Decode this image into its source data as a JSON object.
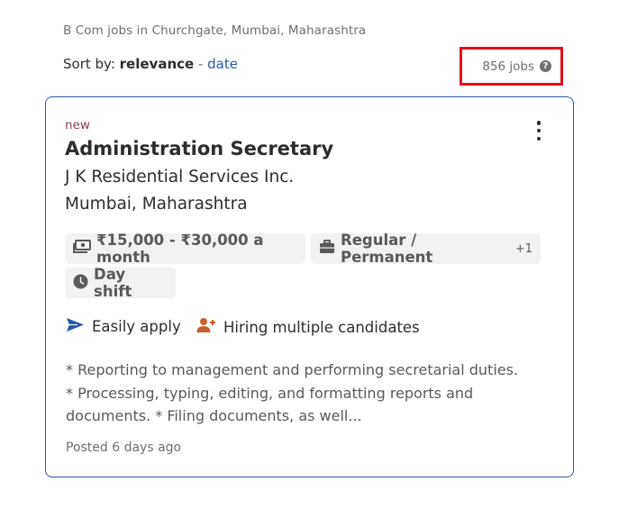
{
  "breadcrumb": "B Com jobs in Churchgate, Mumbai, Maharashtra",
  "sort": {
    "prefix": "Sort by: ",
    "active": "relevance",
    "separator": " - ",
    "alternate": "date"
  },
  "job_count": "856 jobs",
  "job_count_help_icon": "question-circle-icon",
  "card": {
    "new_label": "new",
    "title": "Administration Secretary",
    "company": "J K Residential Services Inc.",
    "location": "Mumbai, Maharashtra",
    "tags": {
      "salary": "₹15,000 - ₹30,000 a month",
      "job_type": "Regular / Permanent",
      "job_type_more": "+1",
      "shift": "Day shift"
    },
    "attributes": {
      "easily_apply": "Easily apply",
      "hiring_multiple": "Hiring multiple candidates"
    },
    "snippet_lines": [
      "* Reporting to management and performing secretarial duties.",
      "* Processing, typing, editing, and formatting reports and",
      "documents. * Filing documents, as well..."
    ],
    "posted": "Posted 6 days ago"
  },
  "colors": {
    "link_blue": "#2557a7",
    "highlight_red": "#e0121b",
    "new_label": "#8c3d5e",
    "hiring_icon_orange": "#c4622d"
  }
}
